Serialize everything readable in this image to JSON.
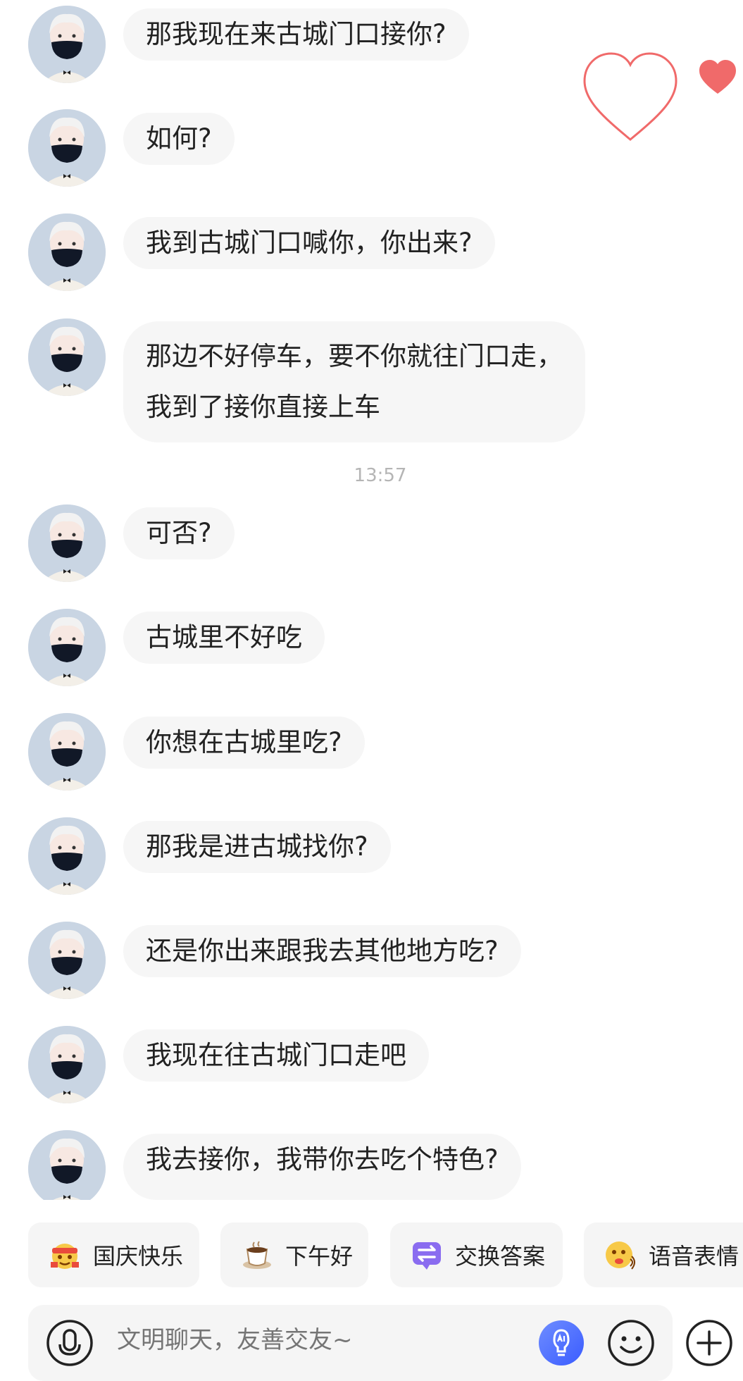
{
  "messages": [
    {
      "lines": [
        "那我现在来古城门口接你?"
      ]
    },
    {
      "lines": [
        "如何?"
      ]
    },
    {
      "lines": [
        "我到古城门口喊你，你出来?"
      ]
    },
    {
      "lines": [
        "那边不好停车，要不你就往门口走，",
        "我到了接你直接上车"
      ]
    },
    {
      "lines": [
        "可否?"
      ]
    },
    {
      "lines": [
        "古城里不好吃"
      ]
    },
    {
      "lines": [
        "你想在古城里吃?"
      ]
    },
    {
      "lines": [
        "那我是进古城找你?"
      ]
    },
    {
      "lines": [
        "还是你出来跟我去其他地方吃?"
      ]
    },
    {
      "lines": [
        "我现在往古城门口走吧"
      ]
    },
    {
      "lines": [
        "我去接你，我带你去吃个特色?"
      ]
    }
  ],
  "timestamp": "13:57",
  "quick_replies": [
    {
      "label": "国庆快乐",
      "icon": "festival-emoji-icon"
    },
    {
      "label": "下午好",
      "icon": "coffee-icon"
    },
    {
      "label": "交换答案",
      "icon": "swap-answer-icon"
    },
    {
      "label": "语音表情",
      "icon": "voice-emoji-icon"
    }
  ],
  "input": {
    "placeholder": "文明聊天，友善交友~"
  },
  "icons": {
    "voice": "voice-icon",
    "ai": "ai-assistant-icon",
    "emoji": "emoji-icon",
    "plus": "plus-icon",
    "hearts": "heart-icon"
  },
  "colors": {
    "bubble": "#f6f6f6",
    "heart": "#f06a6a",
    "ai_button": "#4f7cff",
    "swap_icon": "#8a6cf0"
  }
}
